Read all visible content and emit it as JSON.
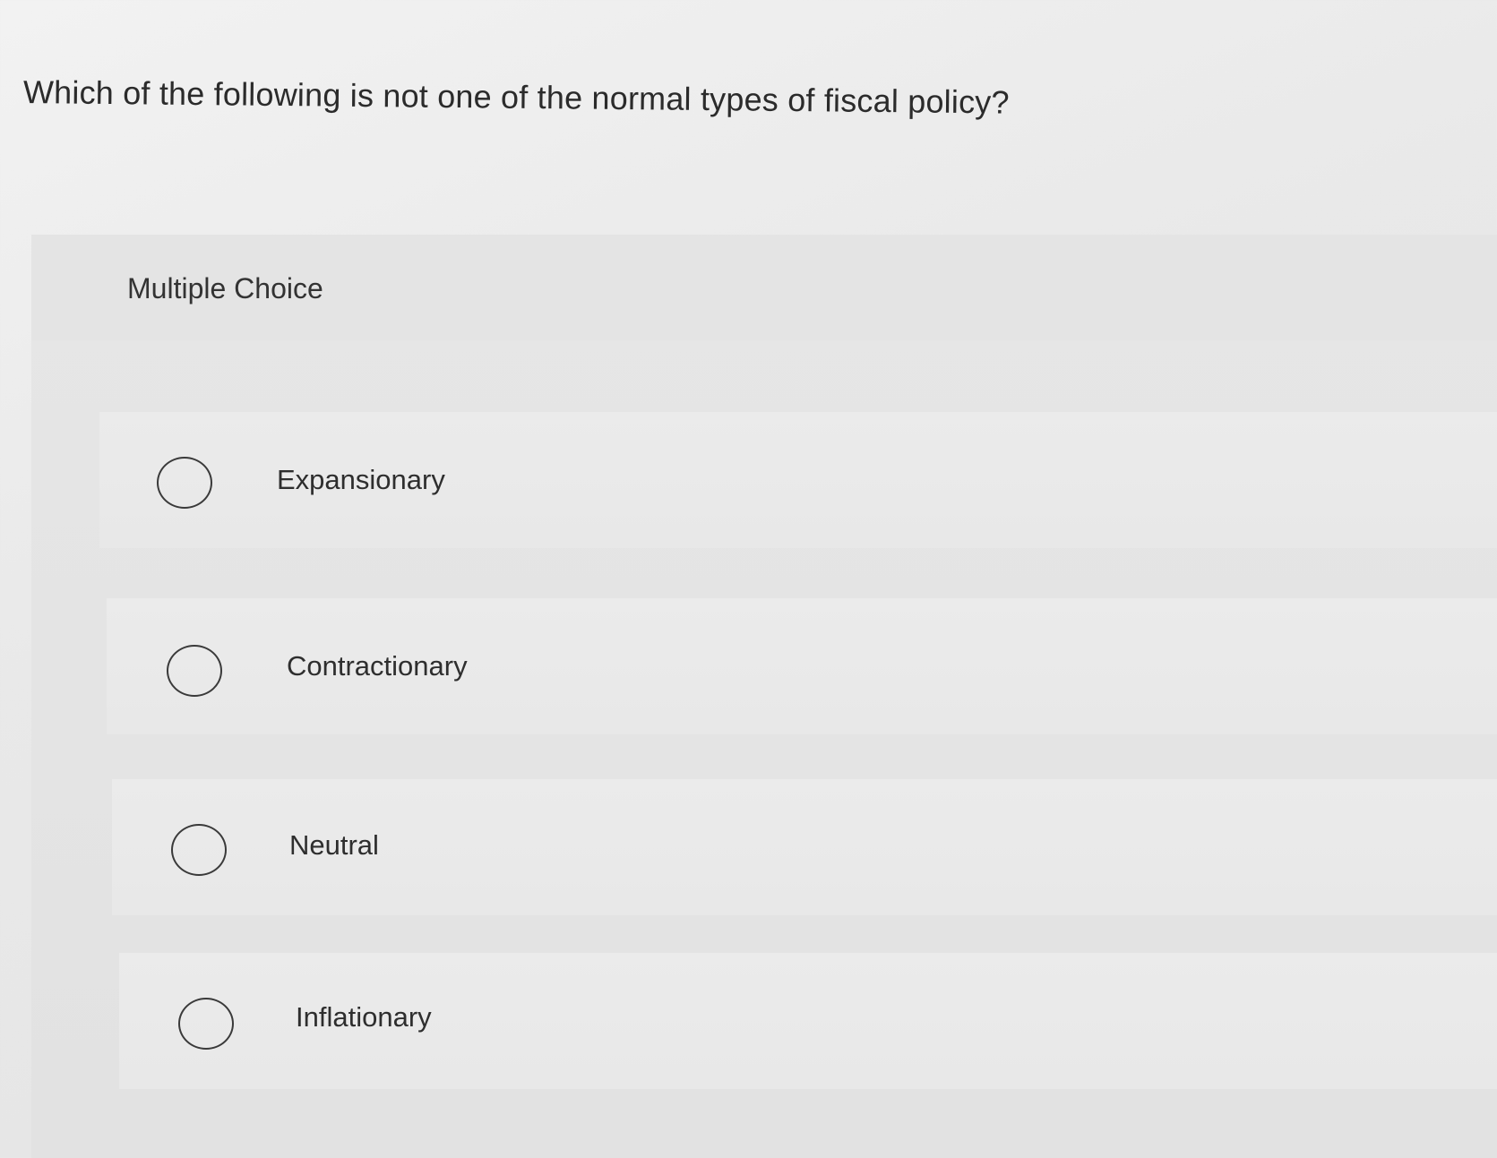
{
  "question": {
    "text": "Which of the following is not one of the normal types of fiscal policy?"
  },
  "multiple_choice": {
    "heading": "Multiple Choice",
    "options": [
      {
        "label": "Expansionary",
        "selected": false
      },
      {
        "label": "Contractionary",
        "selected": false
      },
      {
        "label": "Neutral",
        "selected": false
      },
      {
        "label": "Inflationary",
        "selected": false
      }
    ]
  }
}
